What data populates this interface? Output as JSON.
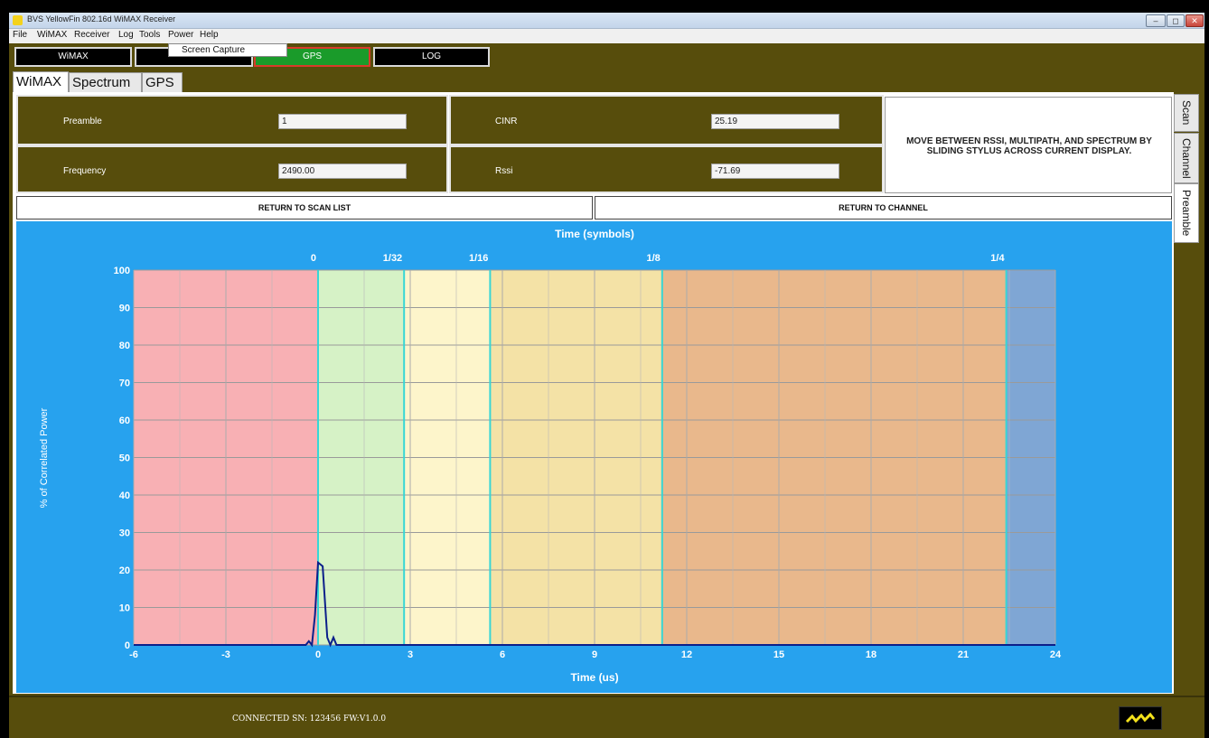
{
  "window": {
    "title": "BVS YellowFin 802.16d WiMAX Receiver",
    "controls": [
      "–",
      "◻",
      "✕"
    ]
  },
  "menu": {
    "items": [
      "File",
      "WiMAX",
      "Receiver",
      "Log",
      "Tools",
      "Power",
      "Help"
    ],
    "dropdown_item": "Screen Capture"
  },
  "top_buttons": {
    "wimax": "WiMAX",
    "receiver": "",
    "gps": "GPS",
    "log": "LOG"
  },
  "tabs": [
    "WiMAX",
    "Spectrum",
    "GPS"
  ],
  "side_tabs": [
    "Scan",
    "Channel",
    "Preamble"
  ],
  "info": {
    "preamble_label": "Preamble",
    "preamble_value": "1",
    "frequency_label": "Frequency",
    "frequency_value": "2490.00",
    "cinr_label": "CINR",
    "cinr_value": "25.19",
    "rssi_label": "Rssi",
    "rssi_value": "-71.69",
    "message": "MOVE BETWEEN RSSI, MULTIPATH, AND SPECTRUM BY SLIDING STYLUS ACROSS CURRENT DISPLAY."
  },
  "buttons": {
    "return_scan": "RETURN TO SCAN LIST",
    "return_channel": "RETURN TO CHANNEL"
  },
  "chart_data": {
    "type": "line",
    "title": "Time (symbols)",
    "xlabel": "Time (us)",
    "ylabel": "% of Correlated Power",
    "xlim": [
      -6,
      24
    ],
    "ylim": [
      0,
      100
    ],
    "x_ticks": [
      -6,
      -3,
      0,
      3,
      6,
      9,
      12,
      15,
      18,
      21,
      24
    ],
    "y_ticks": [
      0,
      10,
      20,
      30,
      40,
      50,
      60,
      70,
      80,
      90,
      100
    ],
    "top_ticks": [
      {
        "label": "0",
        "x": 0
      },
      {
        "label": "1/32",
        "x": 2.8
      },
      {
        "label": "1/16",
        "x": 5.6
      },
      {
        "label": "1/8",
        "x": 11.2
      },
      {
        "label": "1/4",
        "x": 22.4
      }
    ],
    "zones": [
      {
        "from": -6,
        "to": 0,
        "color": "#f8b0b4"
      },
      {
        "from": 0,
        "to": 2.8,
        "color": "#d6f2c6"
      },
      {
        "from": 2.8,
        "to": 5.6,
        "color": "#fdf5cb"
      },
      {
        "from": 5.6,
        "to": 11.2,
        "color": "#f4e2a6"
      },
      {
        "from": 11.2,
        "to": 22.4,
        "color": "#e9b88c"
      },
      {
        "from": 22.4,
        "to": 24,
        "color": "#7fa6d4"
      }
    ],
    "grid": true,
    "series": [
      {
        "color": "#0b1f8a",
        "x": [
          -6,
          -0.4,
          -0.3,
          -0.2,
          -0.1,
          0,
          0.15,
          0.3,
          0.4,
          0.5,
          0.6,
          0.7,
          24
        ],
        "y": [
          0,
          0,
          1,
          0,
          8,
          22,
          21,
          2,
          0,
          2,
          0,
          0,
          0
        ]
      }
    ]
  },
  "status": {
    "text": "CONNECTED SN: 123456   FW:V1.0.0"
  }
}
